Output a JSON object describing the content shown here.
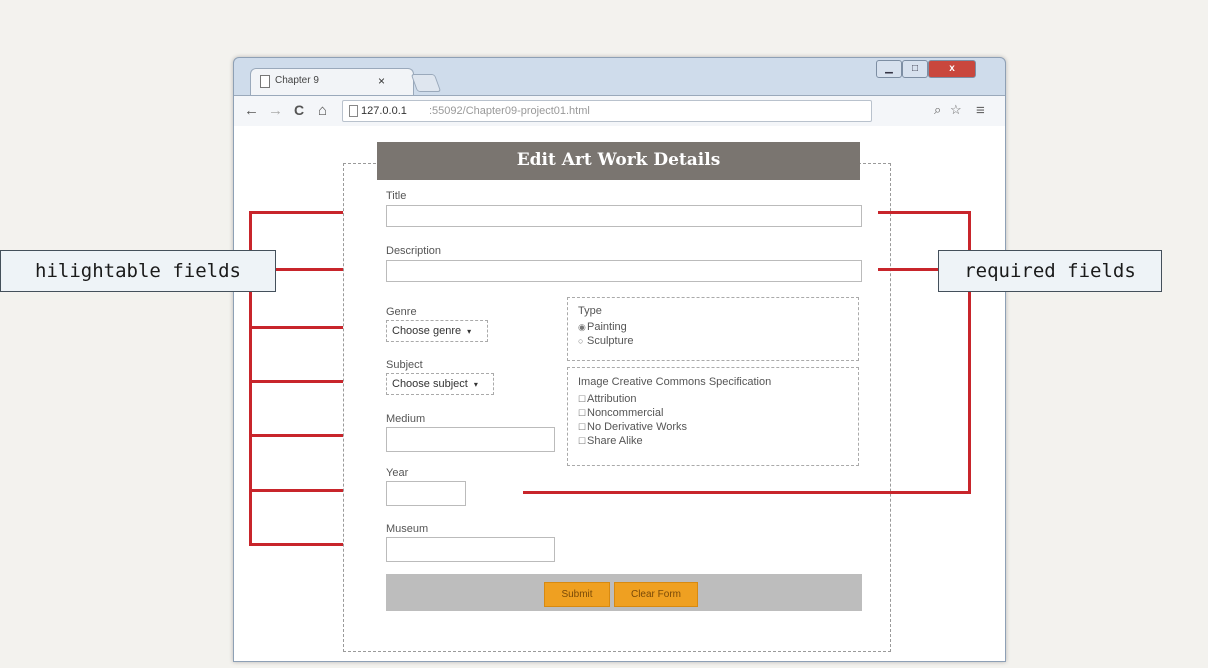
{
  "browser": {
    "tab_title": "Chapter 9",
    "tab_close": "×",
    "window_min": "▁",
    "window_max": "□",
    "window_close": "x",
    "nav": {
      "back": "←",
      "forward": "→",
      "reload": "C",
      "home": "⌂"
    },
    "url_host": "127.0.0.1",
    "url_path": ":55092/Chapter09-project01.html",
    "search_icon": "⌕",
    "star_icon": "☆",
    "menu_icon": "≡"
  },
  "form": {
    "title": "Edit Art Work Details",
    "title_label": "Title",
    "title_value": "",
    "description_label": "Description",
    "description_value": "",
    "genre_label": "Genre",
    "genre_selected": "Choose genre",
    "subject_label": "Subject",
    "subject_selected": "Choose subject",
    "medium_label": "Medium",
    "medium_value": "",
    "year_label": "Year",
    "year_value": "",
    "museum_label": "Museum",
    "museum_value": "",
    "type": {
      "legend": "Type",
      "options": [
        {
          "label": "Painting",
          "checked": true
        },
        {
          "label": "Sculpture",
          "checked": false
        }
      ]
    },
    "cc": {
      "legend": "Image Creative Commons Specification",
      "options": [
        "Attribution",
        "Noncommercial",
        "No Derivative Works",
        "Share Alike"
      ]
    },
    "submit_label": "Submit",
    "clear_label": "Clear Form"
  },
  "callouts": {
    "left": "hilightable fields",
    "right": "required fields"
  },
  "colors": {
    "title_bar": "#7a7570",
    "button": "#efa021",
    "callout_line": "#c8252b"
  }
}
